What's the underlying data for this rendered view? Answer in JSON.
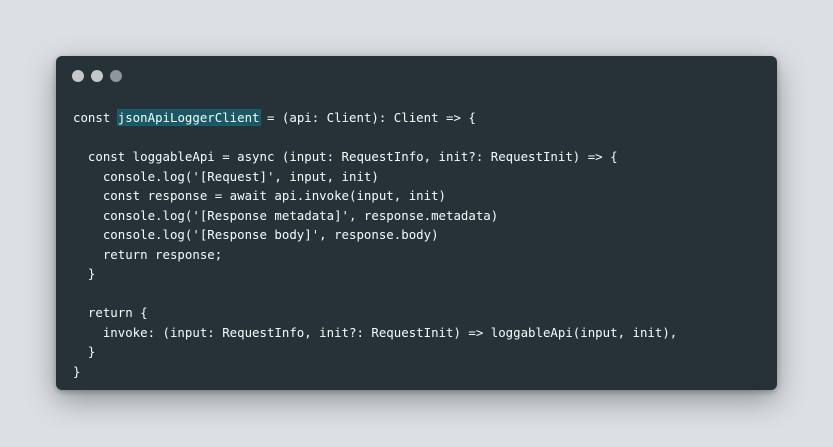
{
  "window": {
    "dot_colors": [
      "#c4c8cb",
      "#c4c8cb",
      "#8f969b"
    ]
  },
  "code": {
    "highlight_color": "#00bcd4",
    "lines": [
      [
        "const ",
        "jsonApiLoggerClient",
        " = (api: Client): Client => {"
      ],
      [
        ""
      ],
      [
        "  const loggableApi = async (input: RequestInfo, init?: RequestInit) => {"
      ],
      [
        "    console.log('[Request]', input, init)"
      ],
      [
        "    const response = await api.invoke(input, init)"
      ],
      [
        "    console.log('[Response metadata]', response.metadata)"
      ],
      [
        "    console.log('[Response body]', response.body)"
      ],
      [
        "    return response;"
      ],
      [
        "  }"
      ],
      [
        ""
      ],
      [
        "  return {"
      ],
      [
        "    invoke: (input: RequestInfo, init?: RequestInit) => loggableApi(input, init),"
      ],
      [
        "  }"
      ],
      [
        "}"
      ]
    ]
  }
}
